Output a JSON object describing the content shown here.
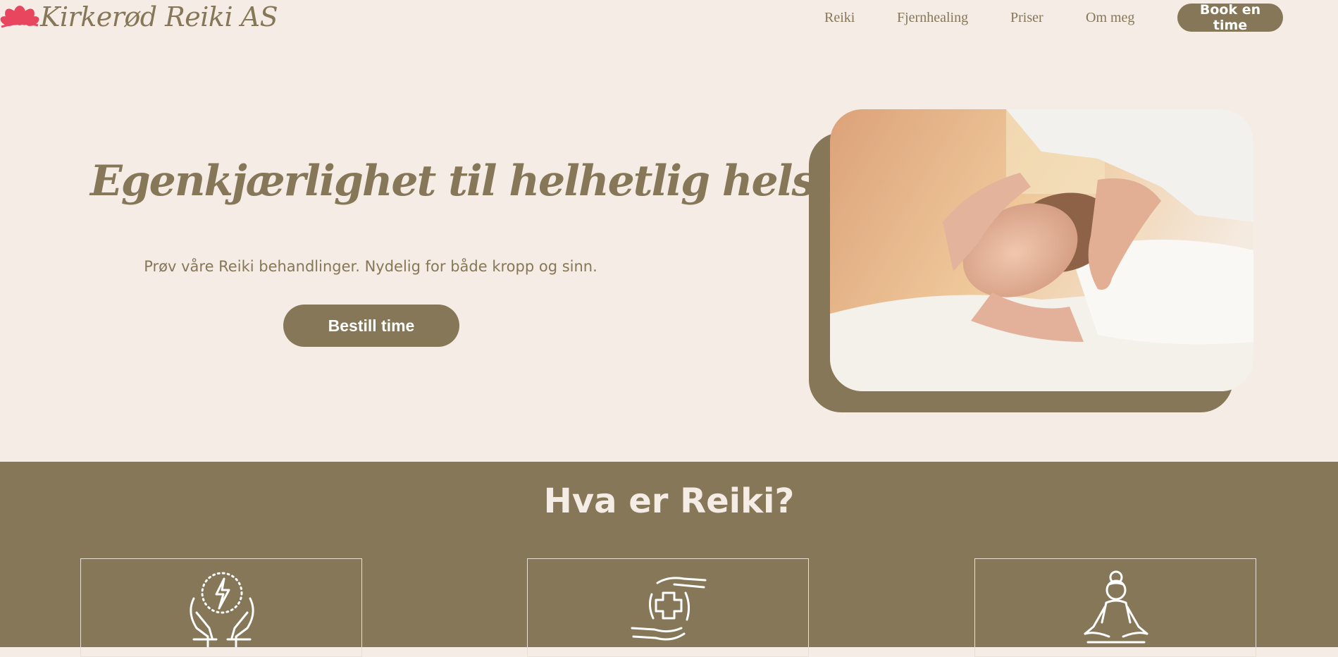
{
  "header": {
    "logo_text": "Kirkerød Reiki AS",
    "nav": [
      "Reiki",
      "Fjernhealing",
      "Priser",
      "Om meg"
    ],
    "book_label": "Book en time"
  },
  "hero": {
    "title": "Egenkjærlighet til helhetlig helse",
    "subtitle": "Prøv våre Reiki behandlinger. Nydelig for både kropp og sinn.",
    "cta_label": "Bestill time"
  },
  "section": {
    "title": "Hva er Reiki?",
    "cards": [
      {
        "icon": "hands-energy-icon"
      },
      {
        "icon": "healing-hands-icon"
      },
      {
        "icon": "meditation-icon"
      }
    ]
  },
  "colors": {
    "background": "#f5ece5",
    "accent": "#857757",
    "logo_flower": "#e8455e"
  }
}
